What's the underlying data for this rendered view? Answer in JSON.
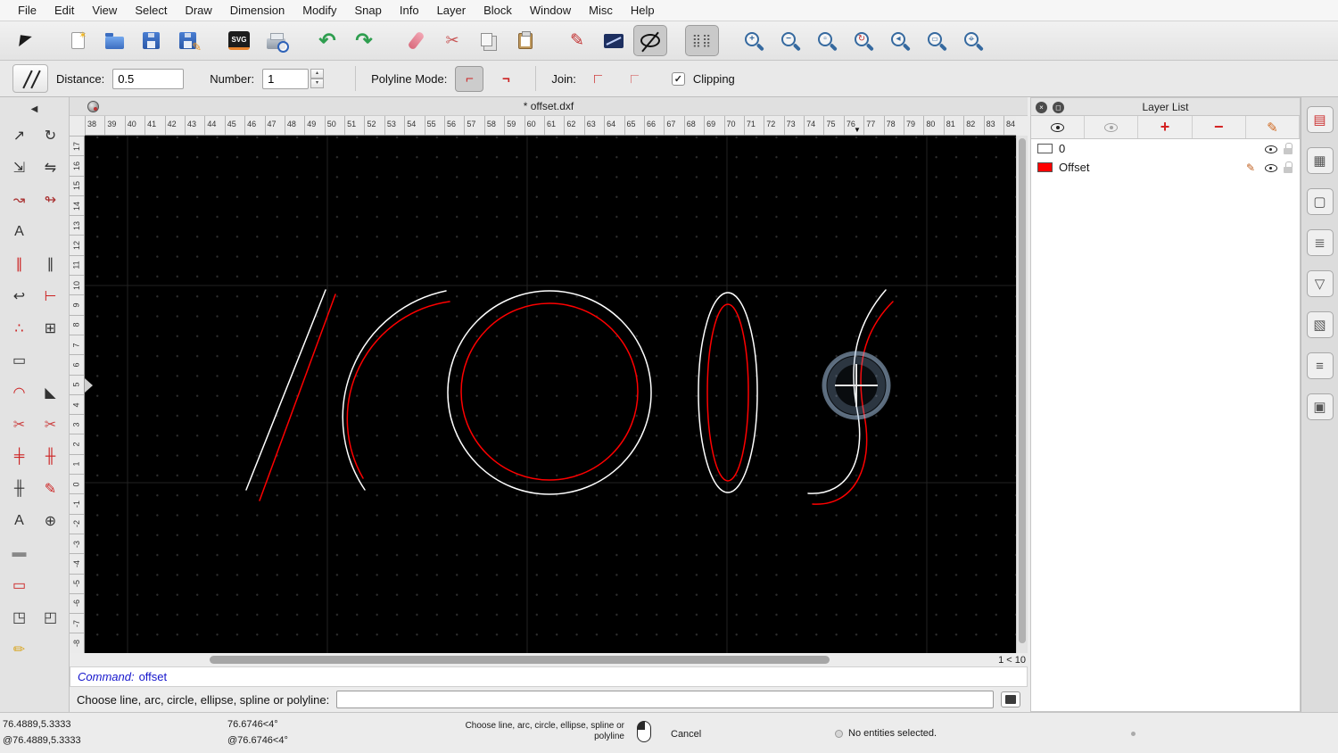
{
  "menu": {
    "items": [
      "File",
      "Edit",
      "View",
      "Select",
      "Draw",
      "Dimension",
      "Modify",
      "Snap",
      "Info",
      "Layer",
      "Block",
      "Window",
      "Misc",
      "Help"
    ]
  },
  "toolbar": {
    "buttons": [
      {
        "name": "select-arrow"
      },
      {
        "name": "new-file",
        "gap": "g"
      },
      {
        "name": "open-folder"
      },
      {
        "name": "save"
      },
      {
        "name": "save-as"
      },
      {
        "name": "svg-export",
        "gap": "g"
      },
      {
        "name": "print-preview"
      },
      {
        "name": "undo",
        "gap": "g"
      },
      {
        "name": "redo"
      },
      {
        "name": "eraser",
        "gap": "g"
      },
      {
        "name": "cut"
      },
      {
        "name": "copy"
      },
      {
        "name": "paste"
      },
      {
        "name": "edit-pen",
        "gap": "g"
      },
      {
        "name": "select-entity"
      },
      {
        "name": "offset-tool",
        "state": "pressed"
      },
      {
        "name": "grid-toggle",
        "gap": "g",
        "state": "pressed"
      },
      {
        "name": "zoom-in",
        "gap": "g"
      },
      {
        "name": "zoom-out"
      },
      {
        "name": "auto-zoom"
      },
      {
        "name": "redraw"
      },
      {
        "name": "previous-view"
      },
      {
        "name": "zoom-window"
      },
      {
        "name": "pan"
      }
    ]
  },
  "options": {
    "distance_label": "Distance:",
    "distance_value": "0.5",
    "number_label": "Number:",
    "number_value": "1",
    "polyline_mode_label": "Polyline Mode:",
    "join_label": "Join:",
    "clipping_label": "Clipping",
    "clipping_checked": true
  },
  "document": {
    "title": "* offset.dxf"
  },
  "rulers": {
    "horizontal": [
      "38",
      "39",
      "40",
      "41",
      "42",
      "43",
      "44",
      "45",
      "46",
      "47",
      "48",
      "49",
      "50",
      "51",
      "52",
      "53",
      "54",
      "55",
      "56",
      "57",
      "58",
      "59",
      "60",
      "61",
      "62",
      "63",
      "64",
      "65",
      "66",
      "67",
      "68",
      "69",
      "70",
      "71",
      "72",
      "73",
      "74",
      "75",
      "76",
      "77",
      "78",
      "79",
      "80",
      "81",
      "82",
      "83",
      "84"
    ],
    "vertical": [
      "17",
      "16",
      "15",
      "14",
      "13",
      "12",
      "11",
      "10",
      "9",
      "8",
      "7",
      "6",
      "5",
      "4",
      "3",
      "2",
      "1",
      "0",
      "-1",
      "-2",
      "-3",
      "-4",
      "-5",
      "-6",
      "-7",
      "-8"
    ]
  },
  "palette": {
    "back_glyph": "◀",
    "tools": [
      {
        "name": "tool-move",
        "glyph": "↗",
        "color": "#333333"
      },
      {
        "name": "tool-rotate",
        "glyph": "↻",
        "color": "#333333"
      },
      {
        "name": "tool-scale",
        "glyph": "⇲",
        "color": "#333333"
      },
      {
        "name": "tool-mirror",
        "glyph": "⇋",
        "color": "#333333"
      },
      {
        "name": "tool-move-rotate",
        "glyph": "↝",
        "color": "#aa3333"
      },
      {
        "name": "tool-rotate-two",
        "glyph": "↬",
        "color": "#aa3333"
      },
      {
        "name": "tool-scale-text",
        "glyph": "A",
        "color": "#333333"
      },
      {
        "name": "empty",
        "glyph": "",
        "state": "blank"
      },
      {
        "name": "tool-offset",
        "glyph": "∥",
        "color": "#cc2222"
      },
      {
        "name": "tool-offset-point",
        "glyph": "∥",
        "color": "#333333"
      },
      {
        "name": "tool-reverse",
        "glyph": "↩",
        "color": "#333333"
      },
      {
        "name": "tool-trim",
        "glyph": "⊢",
        "color": "#cc2222"
      },
      {
        "name": "tool-divide",
        "glyph": "∴",
        "color": "#cc2222"
      },
      {
        "name": "tool-properties",
        "glyph": "⊞",
        "color": "#333333"
      },
      {
        "name": "tool-stretch",
        "glyph": "▭",
        "color": "#333333"
      },
      {
        "name": "empty",
        "glyph": "",
        "state": "blank"
      },
      {
        "name": "tool-round",
        "glyph": "◠",
        "color": "#cc2222"
      },
      {
        "name": "tool-bevel",
        "glyph": "◣",
        "color": "#333333"
      },
      {
        "name": "tool-trim-cut",
        "glyph": "✂",
        "color": "#cc4444"
      },
      {
        "name": "tool-trim-cut-two",
        "glyph": "✂",
        "color": "#cc4444"
      },
      {
        "name": "tool-break-gap",
        "glyph": "╪",
        "color": "#cc2222"
      },
      {
        "name": "tool-break-gap-two",
        "glyph": "╫",
        "color": "#cc2222"
      },
      {
        "name": "tool-auto-trim",
        "glyph": "╫",
        "color": "#333333"
      },
      {
        "name": "tool-edit-pen",
        "glyph": "✎",
        "color": "#cc2222"
      },
      {
        "name": "tool-edit-text",
        "glyph": "A",
        "color": "#333333"
      },
      {
        "name": "tool-linear-format",
        "glyph": "⊕",
        "color": "#333333"
      },
      {
        "name": "tool-brush",
        "glyph": "▬",
        "color": "#888888"
      },
      {
        "name": "empty",
        "glyph": "",
        "state": "blank"
      },
      {
        "name": "tool-eraser",
        "glyph": "▭",
        "color": "#cc2222"
      },
      {
        "name": "empty",
        "glyph": "",
        "state": "blank"
      },
      {
        "name": "tool-explode",
        "glyph": "◳",
        "color": "#333333"
      },
      {
        "name": "tool-explode-text",
        "glyph": "◰",
        "color": "#333333"
      },
      {
        "name": "tool-pencil",
        "glyph": "✏",
        "color": "#d8a520"
      },
      {
        "name": "empty",
        "glyph": "",
        "state": "blank"
      }
    ]
  },
  "canvas": {
    "background": "#000000",
    "scroll_info": "1 < 10",
    "entities": [
      {
        "type": "line",
        "layer": "0",
        "color": "#ffffff"
      },
      {
        "type": "line",
        "layer": "Offset",
        "color": "#ff0000"
      },
      {
        "type": "arc",
        "layer": "0",
        "color": "#ffffff"
      },
      {
        "type": "arc",
        "layer": "Offset",
        "color": "#ff0000"
      },
      {
        "type": "circle",
        "layer": "0",
        "color": "#ffffff"
      },
      {
        "type": "circle",
        "layer": "Offset",
        "color": "#ff0000"
      },
      {
        "type": "ellipse",
        "layer": "0",
        "color": "#ffffff"
      },
      {
        "type": "ellipse",
        "layer": "Offset",
        "color": "#ff0000"
      },
      {
        "type": "spline",
        "layer": "0",
        "color": "#ffffff"
      },
      {
        "type": "spline",
        "layer": "Offset",
        "color": "#ff0000"
      }
    ]
  },
  "layer_panel": {
    "title": "Layer List",
    "toolbar": [
      {
        "name": "show-all-layers-button",
        "icon": "eye"
      },
      {
        "name": "hide-all-layers-button",
        "icon": "eye-off"
      },
      {
        "name": "add-layer-button",
        "icon": "plus"
      },
      {
        "name": "remove-layer-button",
        "icon": "minus"
      },
      {
        "name": "edit-layer-button",
        "icon": "pencil"
      }
    ],
    "layers": [
      {
        "name": "0",
        "color": "#ffffff",
        "current": ""
      },
      {
        "name": "Offset",
        "color": "#ff0000",
        "current": "current"
      }
    ]
  },
  "dock": {
    "panels": [
      {
        "name": "panel-property-editor",
        "glyph": "▤",
        "color": "#cc3333"
      },
      {
        "name": "panel-layer-list",
        "glyph": "▦",
        "color": "#555555"
      },
      {
        "name": "panel-block-list",
        "glyph": "▢",
        "color": "#555555"
      },
      {
        "name": "panel-view-list",
        "glyph": "≣",
        "color": "#555555"
      },
      {
        "name": "panel-selection-filter",
        "glyph": "▽",
        "color": "#555555"
      },
      {
        "name": "panel-library-browser",
        "glyph": "▧",
        "color": "#555555"
      },
      {
        "name": "panel-command-history",
        "glyph": "≡",
        "color": "#555555"
      },
      {
        "name": "panel-clipboard",
        "glyph": "▣",
        "color": "#555555"
      }
    ]
  },
  "command": {
    "history_label": "Command:",
    "history_value": "offset",
    "prompt_label": "Choose line, arc, circle, ellipse, spline or polyline:",
    "input_value": ""
  },
  "status": {
    "abs_coord": "76.4889,5.3333",
    "rel_coord": "@76.4889,5.3333",
    "abs_polar": "76.6746<4°",
    "rel_polar": "@76.6746<4°",
    "hint_line1": "Choose line, arc, circle, ellipse, spline or",
    "hint_line2": "polyline",
    "left_click_label": "Cancel",
    "selection_status": "No entities selected."
  }
}
